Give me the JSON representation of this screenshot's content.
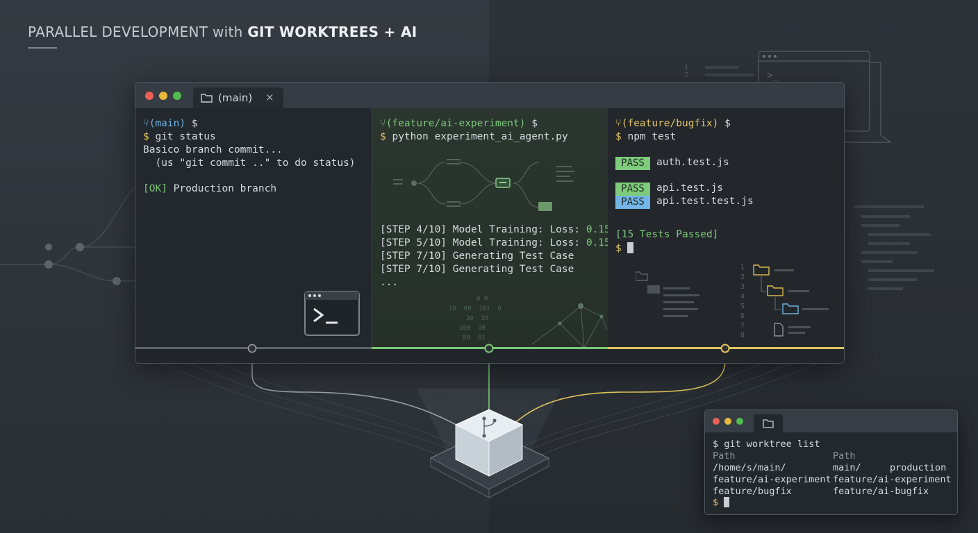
{
  "header": {
    "title_prefix": "PARALLEL DEVELOPMENT with ",
    "title_bold": "GIT WORKTREES + AI"
  },
  "main_window": {
    "tab": {
      "label": "(main)",
      "close_symbol": "×"
    },
    "panes": [
      {
        "branch": "(main)",
        "prompt": "$",
        "command": "git status",
        "output": [
          "Basico branch commit...",
          "  (us \"git commit ..\" to do status)"
        ],
        "ok_tag": "[OK]",
        "ok_text": "Production branch"
      },
      {
        "branch": "(feature/ai-experiment)",
        "prompt": "$",
        "command": "python experiment_ai_agent.py",
        "steps": [
          {
            "tag": "[STEP 4/10]",
            "text": "Model Training: Loss: ",
            "value": "0.15"
          },
          {
            "tag": "[STEP 5/10]",
            "text": "Model Training: Loss: ",
            "value": "0.15"
          },
          {
            "tag": "[STEP 7/10]",
            "text": "Generating Test Case",
            "value": ""
          },
          {
            "tag": "[STEP 7/10]",
            "text": "Generating Test Case",
            "value": ""
          }
        ],
        "ellipsis": "...",
        "binary": [
          "0 0",
          "10  00  101  0",
          "30  30",
          "100  10",
          "00  01"
        ]
      },
      {
        "branch": "(feature/bugfix)",
        "prompt": "$",
        "command": "npm test",
        "tests": [
          {
            "badge": "PASS",
            "file": "auth.test.js",
            "color": "#7ecb7b"
          },
          {
            "badge": "PASS",
            "file": "api.test.js",
            "color": "#7ecb7b"
          },
          {
            "badge": "PASS",
            "file": "api.test.test.js",
            "color": "#72b5e6"
          }
        ],
        "summary": "[15 Tests Passed]",
        "line_numbers": [
          "1",
          "2",
          "3",
          "4",
          "5",
          "6",
          "7",
          "8"
        ]
      }
    ]
  },
  "worktree_window": {
    "command": "git worktree list",
    "header": {
      "left": "Path",
      "right": "Path"
    },
    "rows": [
      {
        "left": "/home/s/main/",
        "right": "main/",
        "note": "production"
      },
      {
        "left": "feature/ai-experiment",
        "right": "feature/ai-experiment",
        "note": ""
      },
      {
        "left": "feature/bugfix",
        "right": "feature/ai-bugfix",
        "note": ""
      }
    ],
    "prompt": "$"
  },
  "background": {
    "terminal_prompt_glyph": ">_",
    "editor_line_numbers": [
      "1",
      "2"
    ]
  },
  "colors": {
    "accent_green": "#79c773",
    "accent_yellow": "#e2c45a",
    "accent_blue": "#6fb4e0",
    "neutral_rail": "#5d646b"
  }
}
